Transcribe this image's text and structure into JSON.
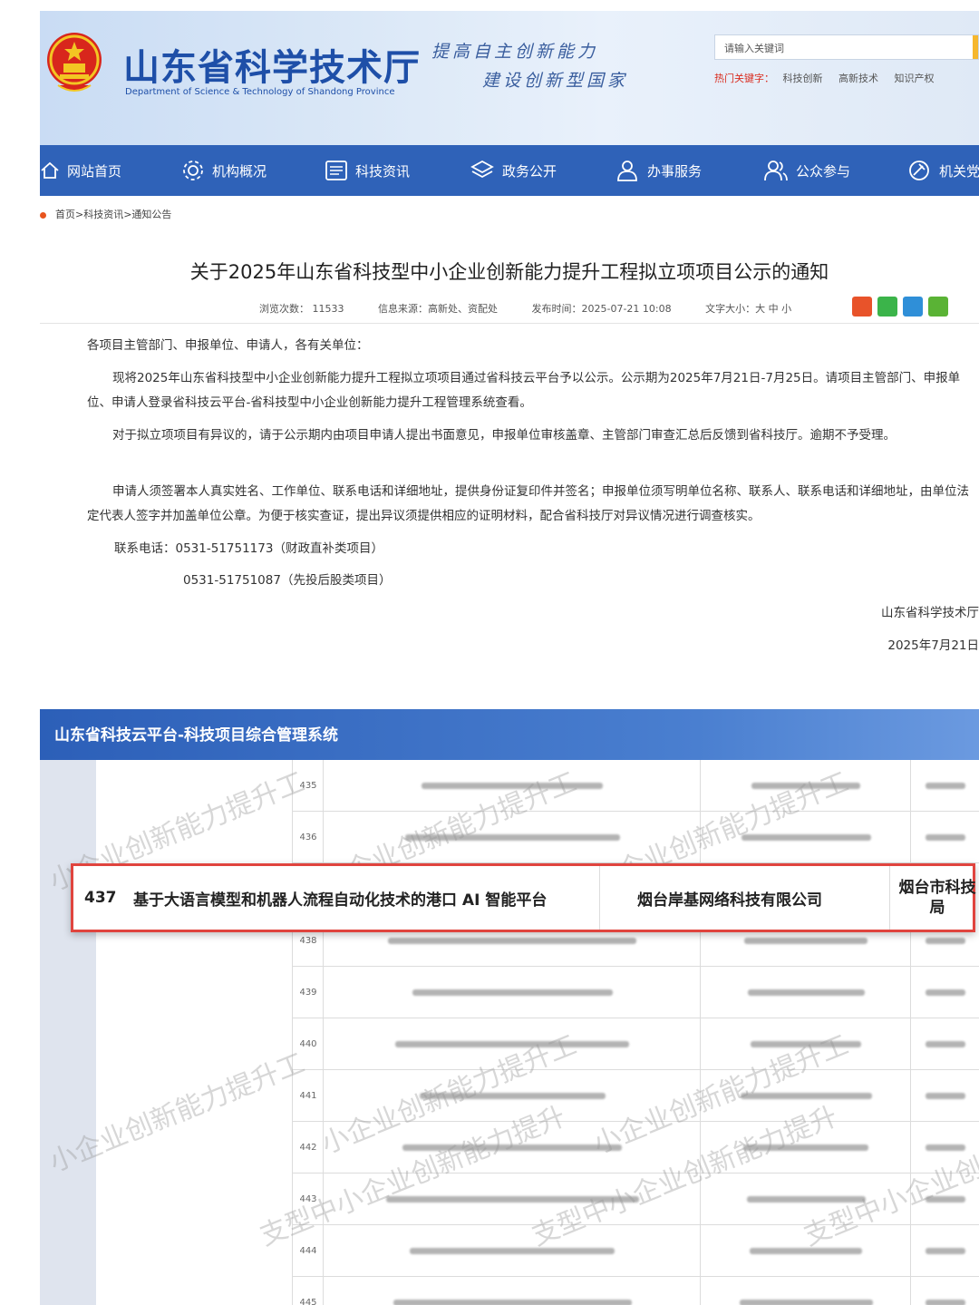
{
  "header": {
    "site_title": "山东省科学技术厅",
    "site_subtitle": "Department of Science & Technology of Shandong Province",
    "slogan_line1": "提高自主创新能力",
    "slogan_line2": "建设创新型国家",
    "search_placeholder": "请输入关键词",
    "hot_label": "热门关键字：",
    "hot_keywords": [
      "科技创新",
      "高新技术",
      "知识产权"
    ]
  },
  "nav": {
    "items": [
      {
        "label": "网站首页",
        "icon": "home-icon"
      },
      {
        "label": "机构概况",
        "icon": "gear-icon"
      },
      {
        "label": "科技资讯",
        "icon": "news-icon"
      },
      {
        "label": "政务公开",
        "icon": "layers-icon"
      },
      {
        "label": "办事服务",
        "icon": "user-service-icon"
      },
      {
        "label": "公众参与",
        "icon": "people-icon"
      },
      {
        "label": "机关党",
        "icon": "party-icon"
      }
    ]
  },
  "breadcrumb": "首页>科技资讯>通知公告",
  "article": {
    "title": "关于2025年山东省科技型中小企业创新能力提升工程拟立项项目公示的通知",
    "meta_views": "浏览次数： 11533",
    "meta_source": "信息来源：高新处、资配处",
    "meta_date": "发布时间：2025-07-21 10:08",
    "meta_font": "文字大小：大 中 小",
    "salutation": "各项目主管部门、申报单位、申请人，各有关单位：",
    "para1": "现将2025年山东省科技型中小企业创新能力提升工程拟立项项目通过省科技云平台予以公示。公示期为2025年7月21日-7月25日。请项目主管部门、申报单位、申请人登录省科技云平台-省科技型中小企业创新能力提升工程管理系统查看。",
    "para2": "对于拟立项项目有异议的，请于公示期内由项目申请人提出书面意见，申报单位审核盖章、主管部门审查汇总后反馈到省科技厅。逾期不予受理。",
    "para3": "申请人须签署本人真实姓名、工作单位、联系电话和详细地址，提供身份证复印件并签名；申报单位须写明单位名称、联系人、联系电话和详细地址，由单位法定代表人签字并加盖单位公章。为便于核实查证，提出异议须提供相应的证明材料，配合省科技厅对异议情况进行调查核实。",
    "phone1": "联系电话：0531-51751173（财政直补类项目）",
    "phone2": "0531-51751087（先投后股类项目）",
    "signature": "山东省科学技术厅",
    "sign_date": "2025年7月21日"
  },
  "system": {
    "title": "山东省科技云平台-科技项目综合管理系统",
    "watermark": "小企业创新能力提升工",
    "watermark2": "支型中小企业创新能力提升",
    "row_numbers": [
      "435",
      "436",
      "438",
      "439",
      "440",
      "441",
      "442",
      "443",
      "444",
      "445"
    ],
    "highlight": {
      "no": "437",
      "project": "基于大语言模型和机器人流程自动化技术的港口 AI 智能平台",
      "company": "烟台岸基网络科技有限公司",
      "authority": "烟台市科技局"
    }
  },
  "colors": {
    "nav_bg": "#2f62b8",
    "title_blue": "#1e4fa8",
    "highlight_border": "#e0443e",
    "hot_red": "#d92c1f"
  }
}
